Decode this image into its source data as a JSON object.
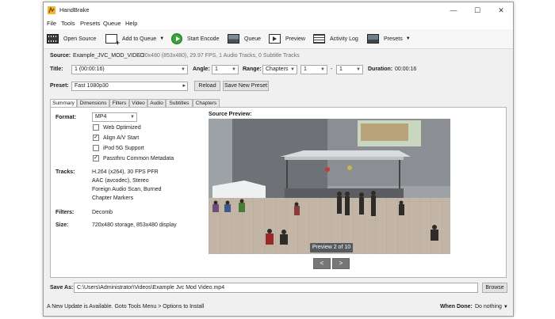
{
  "window": {
    "title": "HandBrake",
    "controls": {
      "minimize": "—",
      "maximize": "☐",
      "close": "✕"
    }
  },
  "menu": [
    "File",
    "Tools",
    "Presets",
    "Queue",
    "Help"
  ],
  "toolbar": {
    "open_source": "Open Source",
    "add_to_queue": "Add to Queue",
    "start_encode": "Start Encode",
    "queue": "Queue",
    "preview": "Preview",
    "activity_log": "Activity Log",
    "presets": "Presets",
    "dropdown_caret": "▼"
  },
  "source": {
    "label": "Source:",
    "name": "Example_JVC_MOD_VIDEO",
    "info": "720x480 (853x480), 29.97 FPS, 1 Audio Tracks, 0 Subtitle Tracks"
  },
  "title_row": {
    "title_label": "Title:",
    "title_value": "1 (00:00:16)",
    "angle_label": "Angle:",
    "angle_value": "1",
    "range_label": "Range:",
    "range_value": "Chapters",
    "range_start": "1",
    "range_sep": "-",
    "range_end": "1",
    "duration_label": "Duration:",
    "duration_value": "00:00:16"
  },
  "preset_row": {
    "label": "Preset:",
    "value": "Fast 1080p30",
    "reload": "Reload",
    "save_new": "Save New Preset",
    "arrow": "▸"
  },
  "tabs": [
    "Summary",
    "Dimensions",
    "Filters",
    "Video",
    "Audio",
    "Subtitles",
    "Chapters"
  ],
  "summary": {
    "format_label": "Format:",
    "format_value": "MP4",
    "options": [
      {
        "label": "Web Optimized",
        "checked": false
      },
      {
        "label": "Align A/V Start",
        "checked": true
      },
      {
        "label": "iPod 5G Support",
        "checked": false
      },
      {
        "label": "Passthru Common Metadata",
        "checked": true
      }
    ],
    "tracks_label": "Tracks:",
    "tracks": [
      "H.264 (x264), 30 FPS PFR",
      "AAC (avcodec), Stereo",
      "Foreign Audio Scan, Burned",
      "Chapter Markers"
    ],
    "filters_label": "Filters:",
    "filters_value": "Decomb",
    "size_label": "Size:",
    "size_value": "720x480 storage, 853x480 display",
    "source_preview_label": "Source Preview:",
    "preview_badge": "Preview 2 of 10",
    "prev_button": "<",
    "next_button": ">"
  },
  "save_as": {
    "label": "Save As:",
    "path": "C:\\Users\\Administrator\\Videos\\Example Jvc Mod Video.mp4",
    "browse": "Browse"
  },
  "status": {
    "message": "A New Update is Available. Goto Tools Menu > Options to Install",
    "when_done_label": "When Done:",
    "when_done_value": "Do nothing"
  },
  "colors": {
    "start_green": "#3aa33a",
    "window_bg": "#f0f0f0"
  }
}
